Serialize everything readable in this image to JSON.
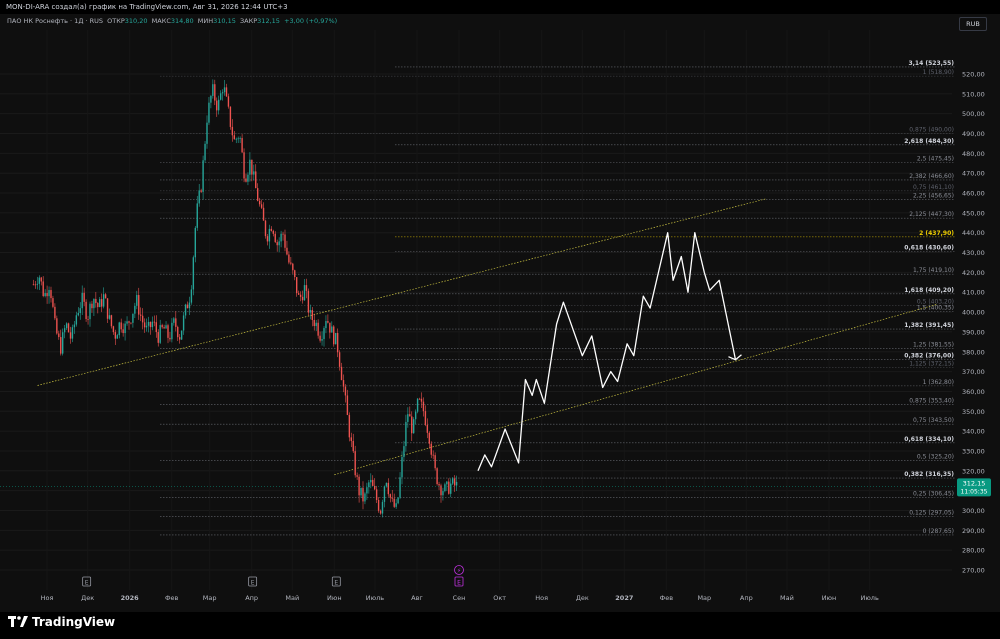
{
  "header": {
    "attribution": "MON-DI-ARA создал(а) график на TradingView.com, Авг 31, 2026 12:44 UTC+3"
  },
  "legend": {
    "symbol": "ПАО НК Роснефть · 1Д · RUS",
    "open_label": "ОТКР",
    "open_value": "310,20",
    "high_label": "МАКС",
    "high_value": "314,80",
    "low_label": "МИН",
    "low_value": "310,15",
    "close_label": "ЗАКР",
    "close_value": "312,15",
    "change": "+3,00 (+0,97%)"
  },
  "currency": "RUB",
  "price_badge": {
    "price": "312,15",
    "countdown": "11:05:35"
  },
  "footer": {
    "brand": "TradingView"
  },
  "colors": {
    "up": "#26a69a",
    "down": "#ef5350",
    "badge": "#089981",
    "gold": "#f0d000",
    "background": "#0f0f0f"
  },
  "chart_data": {
    "type": "candlestick",
    "ylim": [
      265,
      533
    ],
    "y_ticks": [
      "270,00",
      "280,00",
      "290,00",
      "300,00",
      "310,00",
      "320,00",
      "330,00",
      "340,00",
      "350,00",
      "360,00",
      "370,00",
      "380,00",
      "390,00",
      "400,00",
      "410,00",
      "420,00",
      "430,00",
      "440,00",
      "450,00",
      "460,00",
      "470,00",
      "480,00",
      "490,00",
      "500,00",
      "510,00",
      "520,00"
    ],
    "x_labels": [
      "Ноя",
      "Дек",
      "2026",
      "Фев",
      "Мар",
      "Апр",
      "Май",
      "Июн",
      "Июль",
      "Авг",
      "Сен",
      "Окт",
      "Ноя",
      "Дек",
      "2027",
      "Фев",
      "Мар",
      "Апр",
      "Май",
      "Июн",
      "Июль"
    ],
    "bold_x_labels": [
      "2026",
      "2027"
    ],
    "event_markers": [
      {
        "label": "E",
        "month": "Дек"
      },
      {
        "label": "E",
        "month": "Апр"
      },
      {
        "label": "E",
        "month": "Июн"
      },
      {
        "label": "E",
        "month": "Сен"
      },
      {
        "label": "⚡",
        "month": "Сен"
      }
    ],
    "fib_levels": [
      {
        "label": "3,14 (523,55)",
        "price": 523.55,
        "style": "bold"
      },
      {
        "label": "1 (518,90)",
        "price": 518.9,
        "style": "dim"
      },
      {
        "label": "0,875 (490,00)",
        "price": 490.0,
        "style": "dim"
      },
      {
        "label": "2,618 (484,30)",
        "price": 484.3,
        "style": "bold"
      },
      {
        "label": "2,5 (475,45)",
        "price": 475.45,
        "style": "normal"
      },
      {
        "label": "2,382 (466,60)",
        "price": 466.6,
        "style": "normal"
      },
      {
        "label": "0,75 (461,10)",
        "price": 461.1,
        "style": "dim"
      },
      {
        "label": "2,25 (456,65)",
        "price": 456.65,
        "style": "normal"
      },
      {
        "label": "2,125 (447,30)",
        "price": 447.3,
        "style": "normal"
      },
      {
        "label": "2 (437,90)",
        "price": 437.9,
        "style": "gold"
      },
      {
        "label": "0,618 (430,60)",
        "price": 430.6,
        "style": "bold"
      },
      {
        "label": "1,75 (419,10)",
        "price": 419.1,
        "style": "normal"
      },
      {
        "label": "1,618 (409,20)",
        "price": 409.2,
        "style": "bold"
      },
      {
        "label": "0,5 (403,20)",
        "price": 403.2,
        "style": "dim"
      },
      {
        "label": "1,5 (400,35)",
        "price": 400.35,
        "style": "normal"
      },
      {
        "label": "1,382 (391,45)",
        "price": 391.45,
        "style": "bold"
      },
      {
        "label": "1,25 (381,55)",
        "price": 381.55,
        "style": "normal"
      },
      {
        "label": "0,382 (376,00)",
        "price": 376.0,
        "style": "bold"
      },
      {
        "label": "1,125 (372,15)",
        "price": 372.15,
        "style": "dim"
      },
      {
        "label": "1 (362,80)",
        "price": 362.8,
        "style": "normal"
      },
      {
        "label": "0,875 (353,40)",
        "price": 353.4,
        "style": "normal"
      },
      {
        "label": "0,75 (343,50)",
        "price": 343.5,
        "style": "normal"
      },
      {
        "label": "0,618 (334,10)",
        "price": 334.1,
        "style": "bold"
      },
      {
        "label": "0,5 (325,20)",
        "price": 325.2,
        "style": "normal"
      },
      {
        "label": "0,382 (316,35)",
        "price": 316.35,
        "style": "bold"
      },
      {
        "label": "0,25 (306,45)",
        "price": 306.45,
        "style": "normal"
      },
      {
        "label": "0,125 (297,05)",
        "price": 297.05,
        "style": "normal"
      },
      {
        "label": "0 (287,65)",
        "price": 287.65,
        "style": "normal"
      }
    ],
    "price_path": [
      [
        "2025-10-22",
        414
      ],
      [
        "2025-10-26",
        419
      ],
      [
        "2025-10-30",
        408
      ],
      [
        "2025-11-03",
        415
      ],
      [
        "2025-11-07",
        392
      ],
      [
        "2025-11-11",
        382
      ],
      [
        "2025-11-15",
        394
      ],
      [
        "2025-11-19",
        386
      ],
      [
        "2025-11-23",
        400
      ],
      [
        "2025-11-27",
        406
      ],
      [
        "2025-12-01",
        398
      ],
      [
        "2025-12-05",
        408
      ],
      [
        "2025-12-09",
        402
      ],
      [
        "2025-12-13",
        408
      ],
      [
        "2025-12-17",
        396
      ],
      [
        "2025-12-21",
        388
      ],
      [
        "2025-12-25",
        395
      ],
      [
        "2025-12-29",
        392
      ],
      [
        "2026-01-02",
        398
      ],
      [
        "2026-01-06",
        406
      ],
      [
        "2026-01-10",
        396
      ],
      [
        "2026-01-14",
        390
      ],
      [
        "2026-01-18",
        395
      ],
      [
        "2026-01-22",
        388
      ],
      [
        "2026-01-26",
        392
      ],
      [
        "2026-01-30",
        387
      ],
      [
        "2026-02-03",
        395
      ],
      [
        "2026-02-07",
        388
      ],
      [
        "2026-02-11",
        400
      ],
      [
        "2026-02-15",
        410
      ],
      [
        "2026-02-19",
        448
      ],
      [
        "2026-02-23",
        465
      ],
      [
        "2026-02-27",
        498
      ],
      [
        "2026-03-03",
        512
      ],
      [
        "2026-03-07",
        503
      ],
      [
        "2026-03-11",
        515
      ],
      [
        "2026-03-15",
        500
      ],
      [
        "2026-03-19",
        486
      ],
      [
        "2026-03-23",
        490
      ],
      [
        "2026-03-27",
        468
      ],
      [
        "2026-03-31",
        476
      ],
      [
        "2026-04-04",
        462
      ],
      [
        "2026-04-08",
        450
      ],
      [
        "2026-04-12",
        438
      ],
      [
        "2026-04-16",
        445
      ],
      [
        "2026-04-20",
        434
      ],
      [
        "2026-04-24",
        440
      ],
      [
        "2026-04-28",
        426
      ],
      [
        "2026-05-02",
        418
      ],
      [
        "2026-05-06",
        406
      ],
      [
        "2026-05-10",
        412
      ],
      [
        "2026-05-14",
        398
      ],
      [
        "2026-05-18",
        395
      ],
      [
        "2026-05-22",
        388
      ],
      [
        "2026-05-26",
        398
      ],
      [
        "2026-05-30",
        390
      ],
      [
        "2026-06-03",
        384
      ],
      [
        "2026-06-07",
        366
      ],
      [
        "2026-06-11",
        345
      ],
      [
        "2026-06-15",
        326
      ],
      [
        "2026-06-19",
        310
      ],
      [
        "2026-06-23",
        305
      ],
      [
        "2026-06-27",
        315
      ],
      [
        "2026-07-01",
        308
      ],
      [
        "2026-07-05",
        300
      ],
      [
        "2026-07-09",
        318
      ],
      [
        "2026-07-13",
        304
      ],
      [
        "2026-07-17",
        300
      ],
      [
        "2026-07-21",
        325
      ],
      [
        "2026-07-25",
        350
      ],
      [
        "2026-07-29",
        340
      ],
      [
        "2026-08-02",
        355
      ],
      [
        "2026-08-06",
        350
      ],
      [
        "2026-08-10",
        338
      ],
      [
        "2026-08-14",
        320
      ],
      [
        "2026-08-18",
        312
      ],
      [
        "2026-08-22",
        310
      ],
      [
        "2026-08-26",
        313
      ],
      [
        "2026-08-31",
        312.15
      ]
    ],
    "forecast_path": [
      [
        "2026-09-15",
        320
      ],
      [
        "2026-09-20",
        328
      ],
      [
        "2026-09-25",
        322
      ],
      [
        "2026-10-05",
        341
      ],
      [
        "2026-10-15",
        324
      ],
      [
        "2026-10-20",
        366
      ],
      [
        "2026-10-25",
        358
      ],
      [
        "2026-10-28",
        366
      ],
      [
        "2026-11-03",
        354
      ],
      [
        "2026-11-12",
        394
      ],
      [
        "2026-11-17",
        405
      ],
      [
        "2026-12-01",
        378
      ],
      [
        "2026-12-08",
        388
      ],
      [
        "2026-12-16",
        362
      ],
      [
        "2026-12-22",
        370
      ],
      [
        "2026-12-27",
        365
      ],
      [
        "2027-01-03",
        384
      ],
      [
        "2027-01-08",
        378
      ],
      [
        "2027-01-15",
        408
      ],
      [
        "2027-01-20",
        402
      ],
      [
        "2027-02-02",
        440
      ],
      [
        "2027-02-06",
        416
      ],
      [
        "2027-02-12",
        428
      ],
      [
        "2027-02-17",
        410
      ],
      [
        "2027-02-22",
        440
      ],
      [
        "2027-03-01",
        420
      ],
      [
        "2027-03-05",
        411
      ],
      [
        "2027-03-12",
        416
      ],
      [
        "2027-03-24",
        376
      ]
    ],
    "trend_lines": [
      {
        "name": "upper-channel",
        "from": [
          "2025-10-25",
          363
        ],
        "to": [
          "2027-04-15",
          457
        ]
      },
      {
        "name": "lower-channel",
        "from": [
          "2026-06-01",
          318
        ],
        "to": [
          "2027-08-20",
          404
        ]
      }
    ],
    "current_price": 312.15
  }
}
